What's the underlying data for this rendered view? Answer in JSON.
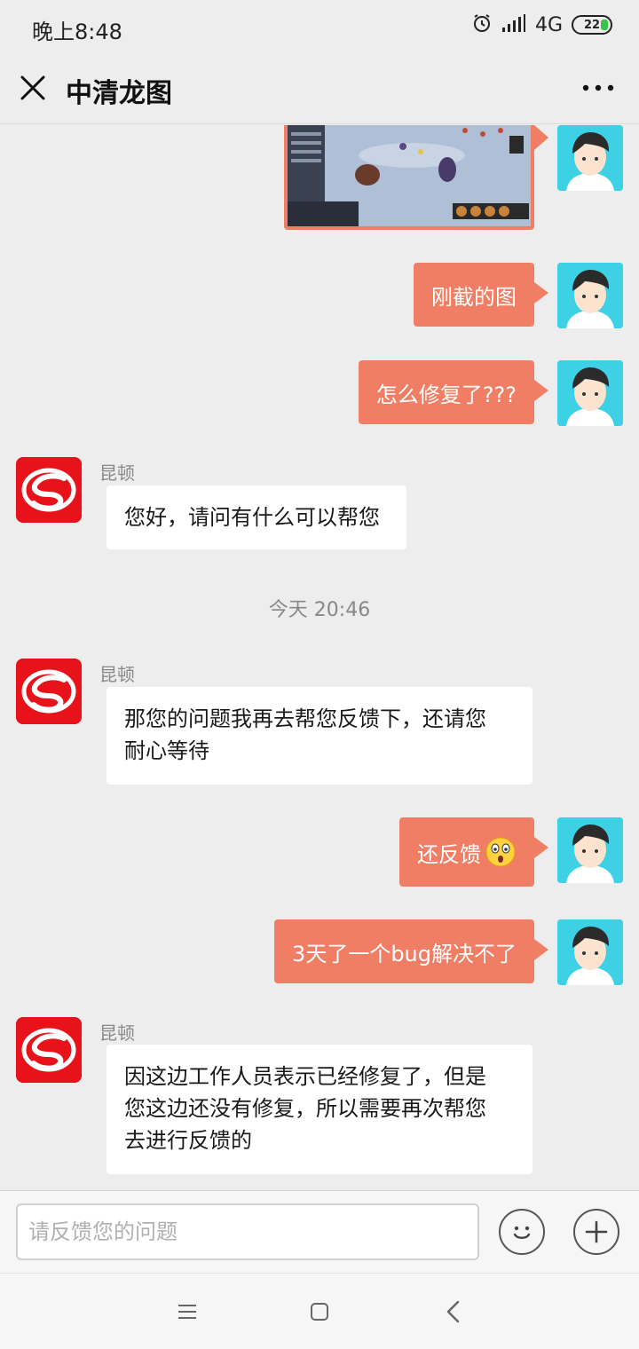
{
  "status_bar": {
    "time": "晚上8:48",
    "network": "4G",
    "battery": "22"
  },
  "header": {
    "title": "中清龙图"
  },
  "messages": {
    "out_1": "刚截的图",
    "out_2": "怎么修复了???",
    "in_1_sender": "昆顿",
    "in_1_text": "您好，请问有什么可以帮您",
    "time_divider": "今天 20:46",
    "in_2_sender": "昆顿",
    "in_2_line1": "那您的问题我再去帮您反馈下，还请您",
    "in_2_line2": "耐心等待",
    "out_3": "还反馈",
    "out_4": "3天了一个bug解决不了",
    "in_3_sender": "昆顿",
    "in_3_line1": "因这边工作人员表示已经修复了，但是",
    "in_3_line2": "您这边还没有修复，所以需要再次帮您",
    "in_3_line3": "去进行反馈的"
  },
  "input": {
    "placeholder": "请反馈您的问题"
  },
  "icons": {
    "close": "close-icon",
    "more": "more-icon",
    "emoji": "emoji-icon",
    "plus": "plus-icon",
    "alarm": "alarm-icon",
    "signal": "signal-icon",
    "nav_menu": "menu-icon",
    "nav_home": "home-icon",
    "nav_back": "back-icon"
  },
  "colors": {
    "accent_bubble": "#ef7e65",
    "brand_red": "#e8121a",
    "avatar_bg": "#3ed0e4"
  }
}
